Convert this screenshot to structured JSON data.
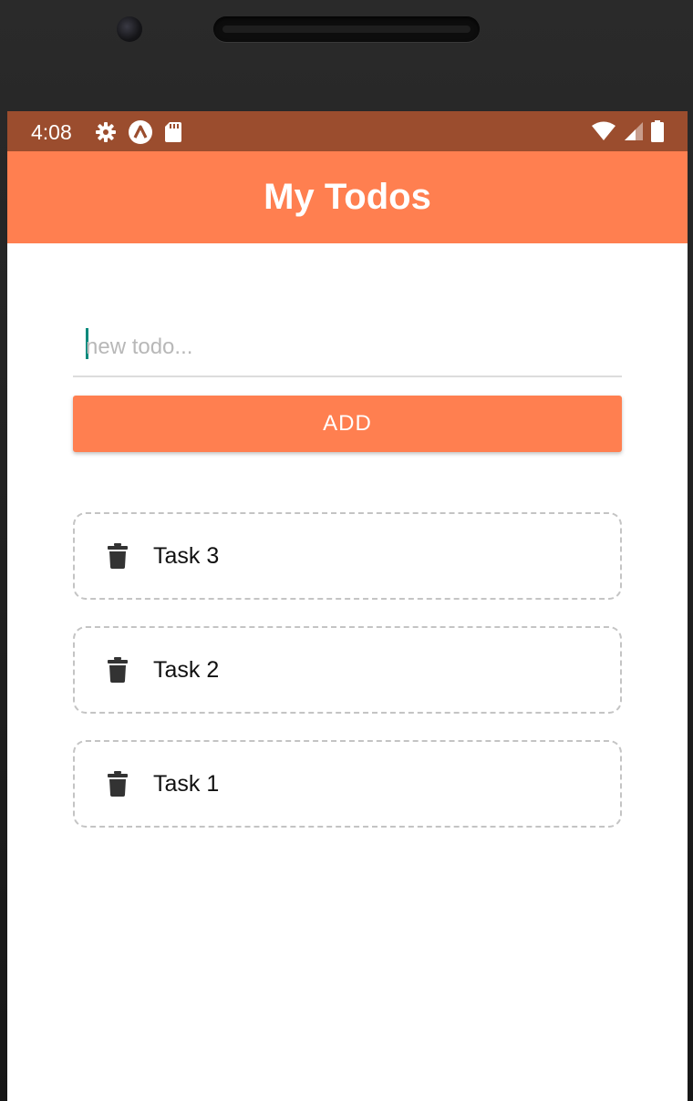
{
  "status_bar": {
    "time": "4:08",
    "left_icons": [
      "settings-icon",
      "app-a-icon",
      "sd-card-icon"
    ],
    "right_icons": [
      "wifi-icon",
      "cellular-signal-icon",
      "battery-icon"
    ],
    "color": "#9b4d2e"
  },
  "app_bar": {
    "title": "My Todos",
    "color": "#ff7f50"
  },
  "new_todo": {
    "placeholder": "new todo...",
    "value": "",
    "cursor_color": "#00897b"
  },
  "add_button": {
    "label": "ADD",
    "color": "#ff7f50"
  },
  "todos": [
    {
      "text": "Task 3",
      "icon": "trash-icon"
    },
    {
      "text": "Task 2",
      "icon": "trash-icon"
    },
    {
      "text": "Task 1",
      "icon": "trash-icon"
    }
  ]
}
